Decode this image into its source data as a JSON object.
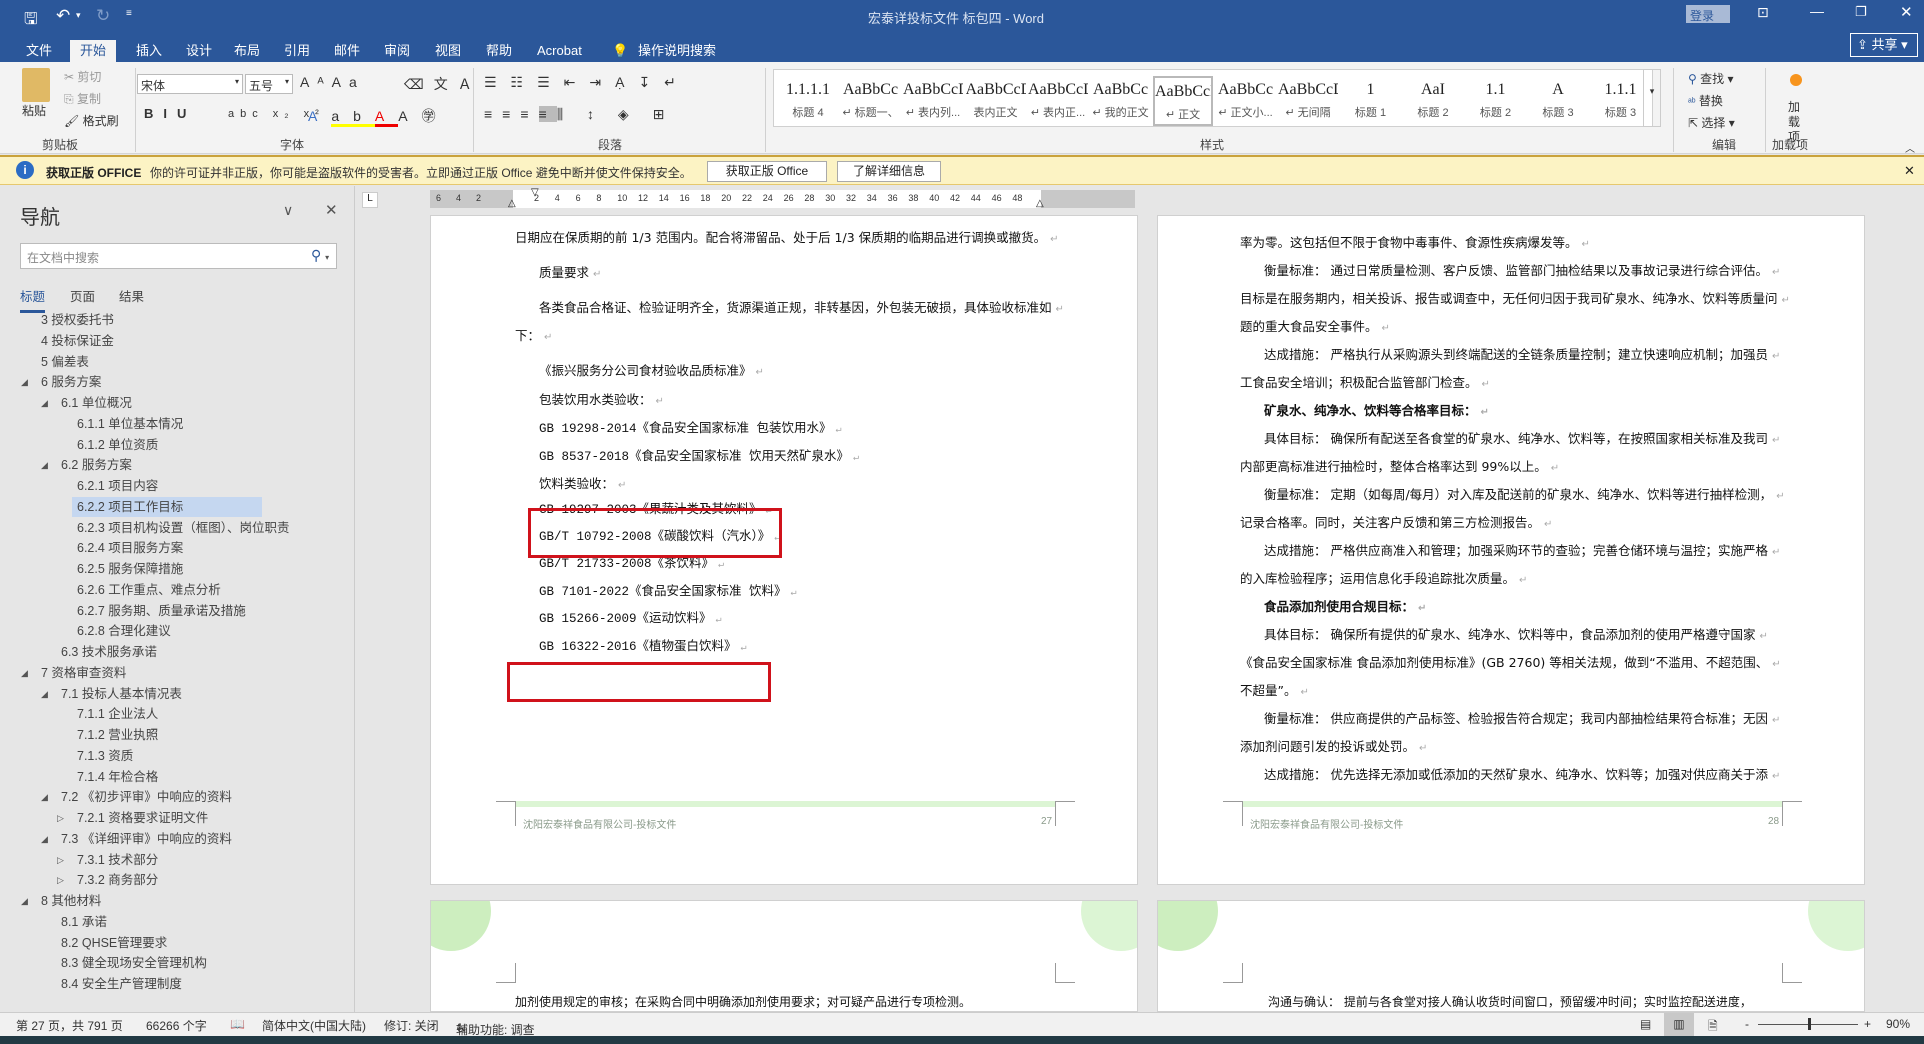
{
  "titlebar": {
    "title": "宏泰详投标文件 标包四  -  Word",
    "login": "登录",
    "share": "共享"
  },
  "tabs": [
    "文件",
    "开始",
    "插入",
    "设计",
    "布局",
    "引用",
    "邮件",
    "审阅",
    "视图",
    "帮助",
    "Acrobat"
  ],
  "active_tab": "开始",
  "tell_me": "操作说明搜索",
  "ribbon": {
    "clipboard": {
      "paste": "粘贴",
      "cut": "剪切",
      "copy": "复制",
      "format_painter": "格式刷",
      "label": "剪贴板"
    },
    "font": {
      "font_name": "宋体",
      "font_size": "五号",
      "label": "字体"
    },
    "paragraph": {
      "label": "段落"
    },
    "styles": {
      "label": "样式",
      "items": [
        {
          "preview": "1.1.1.1",
          "name": "标题 4"
        },
        {
          "preview": "AaBbCc",
          "name": "↵ 标题一、"
        },
        {
          "preview": "AaBbCcD",
          "name": "↵ 表内列..."
        },
        {
          "preview": "AaBbCcDdI",
          "name": "表内正文"
        },
        {
          "preview": "AaBbCcDdI",
          "name": "↵ 表内正..."
        },
        {
          "preview": "AaBbCc",
          "name": "↵ 我的正文"
        },
        {
          "preview": "AaBbCcDc",
          "name": "↵ 正文"
        },
        {
          "preview": "AaBbCc",
          "name": "↵ 正文小..."
        },
        {
          "preview": "AaBbCcDc",
          "name": "↵ 无间隔"
        },
        {
          "preview": "1",
          "name": "标题 1"
        },
        {
          "preview": "AaI",
          "name": "标题 2"
        },
        {
          "preview": "1.1",
          "name": "标题 2"
        },
        {
          "preview": "A",
          "name": "标题 3"
        },
        {
          "preview": "1.1.1",
          "name": "标题 3"
        }
      ],
      "selected": "↵ 正文"
    },
    "editing": {
      "find": "查找",
      "replace": "替换",
      "select": "选择",
      "label": "编辑"
    },
    "addins": {
      "button": "加载项",
      "label": "加载项"
    }
  },
  "infobar": {
    "title": "获取正版 OFFICE",
    "message": "你的许可证并非正版，你可能是盗版软件的受害者。立即通过正版 Office 避免中断并使文件保持安全。",
    "btn_get": "获取正版 Office",
    "btn_learn": "了解详细信息"
  },
  "nav": {
    "title": "导航",
    "search_placeholder": "在文档中搜索",
    "tabs": [
      "标题",
      "页面",
      "结果"
    ],
    "active_tab": "标题",
    "items": [
      {
        "text": "3 授权委托书",
        "level": 1,
        "toggle": ""
      },
      {
        "text": "4 投标保证金",
        "level": 1,
        "toggle": ""
      },
      {
        "text": "5 偏差表",
        "level": 1,
        "toggle": ""
      },
      {
        "text": "6 服务方案",
        "level": 1,
        "toggle": "expanded"
      },
      {
        "text": "6.1 单位概况",
        "level": 2,
        "toggle": "expanded"
      },
      {
        "text": "6.1.1 单位基本情况",
        "level": 3,
        "toggle": ""
      },
      {
        "text": "6.1.2 单位资质",
        "level": 3,
        "toggle": ""
      },
      {
        "text": "6.2 服务方案",
        "level": 2,
        "toggle": "expanded"
      },
      {
        "text": "6.2.1 项目内容",
        "level": 3,
        "toggle": ""
      },
      {
        "text": "6.2.2 项目工作目标",
        "level": 3,
        "toggle": "",
        "selected": true
      },
      {
        "text": "6.2.3 项目机构设置（框图）、岗位职责",
        "level": 3,
        "toggle": ""
      },
      {
        "text": "6.2.4 项目服务方案",
        "level": 3,
        "toggle": ""
      },
      {
        "text": "6.2.5 服务保障措施",
        "level": 3,
        "toggle": ""
      },
      {
        "text": "6.2.6 工作重点、难点分析",
        "level": 3,
        "toggle": ""
      },
      {
        "text": "6.2.7 服务期、质量承诺及措施",
        "level": 3,
        "toggle": ""
      },
      {
        "text": "6.2.8 合理化建议",
        "level": 3,
        "toggle": ""
      },
      {
        "text": "6.3 技术服务承诺",
        "level": 2,
        "toggle": ""
      },
      {
        "text": "7 资格审查资料",
        "level": 1,
        "toggle": "expanded"
      },
      {
        "text": "7.1 投标人基本情况表",
        "level": 2,
        "toggle": "expanded"
      },
      {
        "text": "7.1.1 企业法人",
        "level": 3,
        "toggle": ""
      },
      {
        "text": "7.1.2 营业执照",
        "level": 3,
        "toggle": ""
      },
      {
        "text": "7.1.3 资质",
        "level": 3,
        "toggle": ""
      },
      {
        "text": "7.1.4 年检合格",
        "level": 3,
        "toggle": ""
      },
      {
        "text": "7.2 《初步评审》中响应的资料",
        "level": 2,
        "toggle": "expanded"
      },
      {
        "text": "7.2.1 资格要求证明文件",
        "level": 3,
        "toggle": "collapsed"
      },
      {
        "text": "7.3 《详细评审》中响应的资料",
        "level": 2,
        "toggle": "expanded"
      },
      {
        "text": "7.3.1 技术部分",
        "level": 3,
        "toggle": "collapsed"
      },
      {
        "text": "7.3.2 商务部分",
        "level": 3,
        "toggle": "collapsed"
      },
      {
        "text": "8 其他材料",
        "level": 1,
        "toggle": "expanded"
      },
      {
        "text": "8.1 承诺",
        "level": 2,
        "toggle": ""
      },
      {
        "text": "8.2 QHSE管理要求",
        "level": 2,
        "toggle": ""
      },
      {
        "text": "8.3 健全现场安全管理机构",
        "level": 2,
        "toggle": ""
      },
      {
        "text": "8.4 安全生产管理制度",
        "level": 2,
        "toggle": ""
      }
    ]
  },
  "ruler": {
    "ticks": [
      "6",
      "4",
      "2",
      "2",
      "4",
      "6",
      "8",
      "10",
      "12",
      "14",
      "16",
      "18",
      "20",
      "22",
      "24",
      "26",
      "28",
      "30",
      "32",
      "34",
      "36",
      "38",
      "40",
      "42",
      "44",
      "46",
      "48"
    ]
  },
  "page_left": {
    "lines": [
      {
        "text": "日期应在保质期的前 1/3 范围内。配合将滞留品、处于后 1/3 保质期的临期品进行调换或撤货。",
        "indent": false
      },
      {
        "text": "质量要求",
        "indent": true
      },
      {
        "text": "各类食品合格证、检验证明齐全，货源渠道正规，非转基因，外包装无破损，具体验收标准如",
        "indent": true
      },
      {
        "text": "下：",
        "indent": false
      },
      {
        "text": "《振兴服务分公司食材验收品质标准》",
        "indent": true
      },
      {
        "text": "包装饮用水类验收：",
        "indent": true
      },
      {
        "text": "GB 19298-2014《食品安全国家标准  包装饮用水》",
        "indent": true
      },
      {
        "text": "GB 8537-2018《食品安全国家标准 饮用天然矿泉水》",
        "indent": true
      },
      {
        "text": "饮料类验收：",
        "indent": true
      },
      {
        "text": "GB 19297-2003《果蔬汁类及其饮料》",
        "indent": true,
        "highlighted": true
      },
      {
        "text": "GB/T 10792-2008《碳酸饮料（汽水）》",
        "indent": true
      },
      {
        "text": "GB/T 21733-2008《茶饮料》",
        "indent": true
      },
      {
        "text": "GB 7101-2022《食品安全国家标准 饮料》",
        "indent": true
      },
      {
        "text": "GB 15266-2009《运动饮料》",
        "indent": true
      },
      {
        "text": "GB 16322-2016《植物蛋白饮料》",
        "indent": true,
        "highlighted": true
      }
    ],
    "footer": "沈阳宏泰祥食品有限公司-投标文件",
    "page_no": "27"
  },
  "page_right": {
    "lines": [
      {
        "text": "率为零。这包括但不限于食物中毒事件、食源性疾病爆发等。",
        "indent": false
      },
      {
        "text": "衡量标准：  通过日常质量检测、客户反馈、监管部门抽检结果以及事故记录进行综合评估。",
        "indent": true
      },
      {
        "text": "目标是在服务期内，相关投诉、报告或调查中，无任何归因于我司矿泉水、纯净水、饮料等质量问",
        "indent": false
      },
      {
        "text": "题的重大食品安全事件。",
        "indent": false
      },
      {
        "text": "达成措施：  严格执行从采购源头到终端配送的全链条质量控制；建立快速响应机制；加强员",
        "indent": true
      },
      {
        "text": "工食品安全培训；积极配合监管部门检查。",
        "indent": false
      },
      {
        "text": "矿泉水、纯净水、饮料等合格率目标：",
        "indent": true,
        "bold": true
      },
      {
        "text": "具体目标：  确保所有配送至各食堂的矿泉水、纯净水、饮料等，在按照国家相关标准及我司",
        "indent": true
      },
      {
        "text": "内部更高标准进行抽检时，整体合格率达到 99%以上。",
        "indent": false
      },
      {
        "text": "衡量标准：  定期（如每周/每月）对入库及配送前的矿泉水、纯净水、饮料等进行抽样检测，",
        "indent": true
      },
      {
        "text": "记录合格率。同时，关注客户反馈和第三方检测报告。",
        "indent": false
      },
      {
        "text": "达成措施：  严格供应商准入和管理；加强采购环节的查验；完善仓储环境与温控；实施严格",
        "indent": true
      },
      {
        "text": "的入库检验程序；运用信息化手段追踪批次质量。",
        "indent": false
      },
      {
        "text": "食品添加剂使用合规目标：",
        "indent": true,
        "bold": true
      },
      {
        "text": "具体目标：  确保所有提供的矿泉水、纯净水、饮料等中，食品添加剂的使用严格遵守国家",
        "indent": true
      },
      {
        "text": "《食品安全国家标准  食品添加剂使用标准》(GB 2760) 等相关法规，做到“不滥用、不超范围、",
        "indent": false
      },
      {
        "text": "不超量”。",
        "indent": false
      },
      {
        "text": "衡量标准：  供应商提供的产品标签、检验报告符合规定；我司内部抽检结果符合标准；无因",
        "indent": true
      },
      {
        "text": "添加剂问题引发的投诉或处罚。",
        "indent": false
      },
      {
        "text": "达成措施：  优先选择无添加或低添加的天然矿泉水、纯净水、饮料等；加强对供应商关于添",
        "indent": true
      }
    ],
    "footer": "沈阳宏泰祥食品有限公司-投标文件",
    "page_no": "28"
  },
  "page_lower_left": {
    "text": "加剂使用规定的审核；在采购合同中明确添加剂使用要求；对可疑产品进行专项检测。"
  },
  "page_lower_right": {
    "text": "沟通与确认：  提前与各食堂对接人确认收货时间窗口，预留缓冲时间；实时监控配送进度，"
  },
  "status": {
    "page": "第 27 页，共 791 页",
    "words": "66266 个字",
    "language": "简体中文(中国大陆)",
    "track": "修订: 关闭",
    "accessibility": "辅助功能: 调查",
    "zoom": "90%",
    "zoom_percent": 90
  },
  "colors": {
    "brand": "#2b579a",
    "highlight_box": "#d0121b",
    "info_bar": "#fcf3c4",
    "nav_selected": "#c5d7f0"
  }
}
